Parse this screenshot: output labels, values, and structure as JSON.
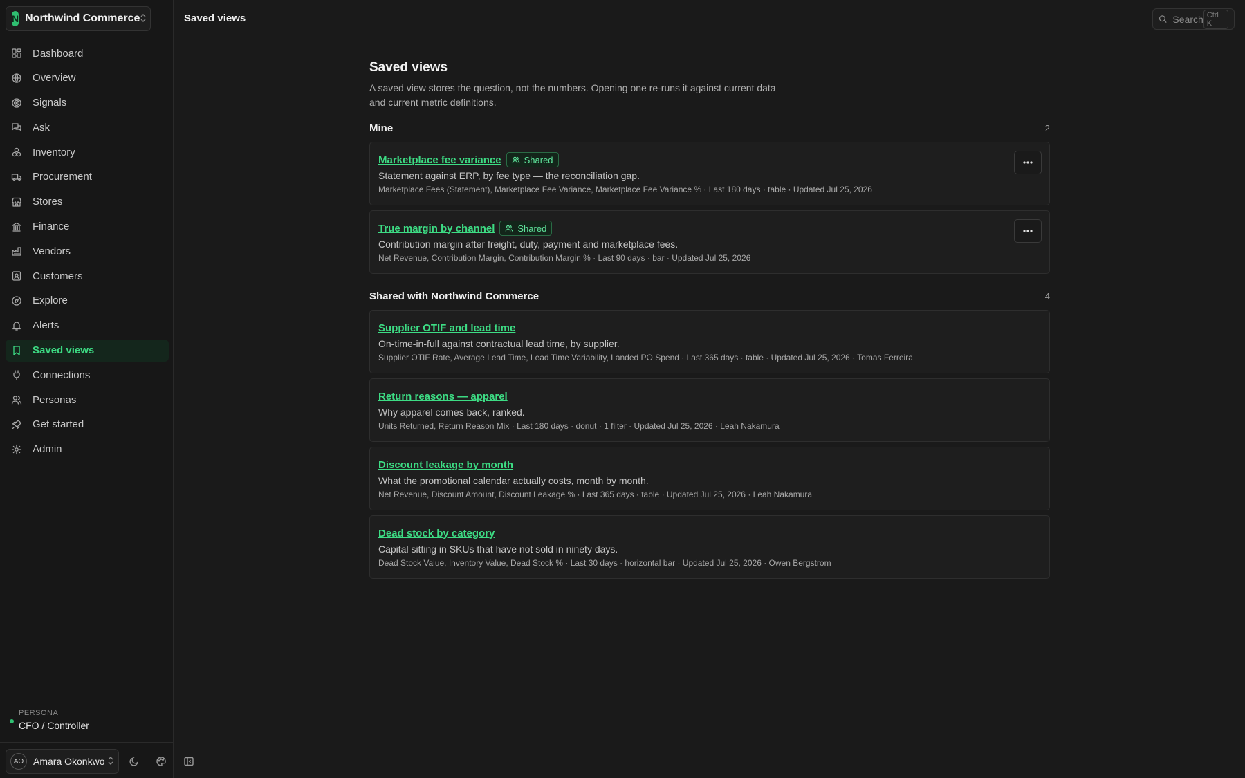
{
  "org": {
    "initial": "N",
    "name": "Northwind Commerce"
  },
  "nav": [
    {
      "label": "Dashboard",
      "icon": "dashboard-icon",
      "active": false
    },
    {
      "label": "Overview",
      "icon": "globe-icon",
      "active": false
    },
    {
      "label": "Signals",
      "icon": "radar-icon",
      "active": false
    },
    {
      "label": "Ask",
      "icon": "chat-icon",
      "active": false
    },
    {
      "label": "Inventory",
      "icon": "boxes-icon",
      "active": false
    },
    {
      "label": "Procurement",
      "icon": "truck-icon",
      "active": false
    },
    {
      "label": "Stores",
      "icon": "store-icon",
      "active": false
    },
    {
      "label": "Finance",
      "icon": "bank-icon",
      "active": false
    },
    {
      "label": "Vendors",
      "icon": "factory-icon",
      "active": false
    },
    {
      "label": "Customers",
      "icon": "contact-icon",
      "active": false
    },
    {
      "label": "Explore",
      "icon": "compass-icon",
      "active": false
    },
    {
      "label": "Alerts",
      "icon": "bell-icon",
      "active": false
    },
    {
      "label": "Saved views",
      "icon": "bookmark-icon",
      "active": true
    },
    {
      "label": "Connections",
      "icon": "plug-icon",
      "active": false
    },
    {
      "label": "Personas",
      "icon": "users-icon",
      "active": false
    },
    {
      "label": "Get started",
      "icon": "rocket-icon",
      "active": false
    },
    {
      "label": "Admin",
      "icon": "gear-icon",
      "active": false
    }
  ],
  "persona": {
    "kicker": "PERSONA",
    "name": "CFO / Controller"
  },
  "user": {
    "initials": "AO",
    "name": "Amara Okonkwo"
  },
  "topbar": {
    "title": "Saved views",
    "search_label": "Search",
    "search_shortcut": "Ctrl K"
  },
  "page": {
    "title": "Saved views",
    "description": "A saved view stores the question, not the numbers. Opening one re-runs it against current data and current metric definitions."
  },
  "sections": [
    {
      "title": "Mine",
      "count": "2",
      "cards": [
        {
          "title": "Marketplace fee variance",
          "badge": "Shared",
          "description": "Statement against ERP, by fee type — the reconciliation gap.",
          "meta": "Marketplace Fees (Statement), Marketplace Fee Variance, Marketplace Fee Variance % · Last 180 days · table · Updated Jul 25, 2026",
          "has_menu": true
        },
        {
          "title": "True margin by channel",
          "badge": "Shared",
          "description": "Contribution margin after freight, duty, payment and marketplace fees.",
          "meta": "Net Revenue, Contribution Margin, Contribution Margin % · Last 90 days · bar · Updated Jul 25, 2026",
          "has_menu": true
        }
      ]
    },
    {
      "title": "Shared with Northwind Commerce",
      "count": "4",
      "cards": [
        {
          "title": "Supplier OTIF and lead time",
          "badge": null,
          "description": "On-time-in-full against contractual lead time, by supplier.",
          "meta": "Supplier OTIF Rate, Average Lead Time, Lead Time Variability, Landed PO Spend · Last 365 days · table · Updated Jul 25, 2026 · Tomas Ferreira",
          "has_menu": false
        },
        {
          "title": "Return reasons — apparel",
          "badge": null,
          "description": "Why apparel comes back, ranked.",
          "meta": "Units Returned, Return Reason Mix · Last 180 days · donut · 1 filter · Updated Jul 25, 2026 · Leah Nakamura",
          "has_menu": false
        },
        {
          "title": "Discount leakage by month",
          "badge": null,
          "description": "What the promotional calendar actually costs, month by month.",
          "meta": "Net Revenue, Discount Amount, Discount Leakage % · Last 365 days · table · Updated Jul 25, 2026 · Leah Nakamura",
          "has_menu": false
        },
        {
          "title": "Dead stock by category",
          "badge": null,
          "description": "Capital sitting in SKUs that have not sold in ninety days.",
          "meta": "Dead Stock Value, Inventory Value, Dead Stock % · Last 30 days · horizontal bar · Updated Jul 25, 2026 · Owen Bergstrom",
          "has_menu": false
        }
      ]
    }
  ],
  "colors": {
    "accent": "#3ddc84",
    "background": "#1a1a1a",
    "sidebar": "#171717",
    "card": "#1e1e1e"
  }
}
